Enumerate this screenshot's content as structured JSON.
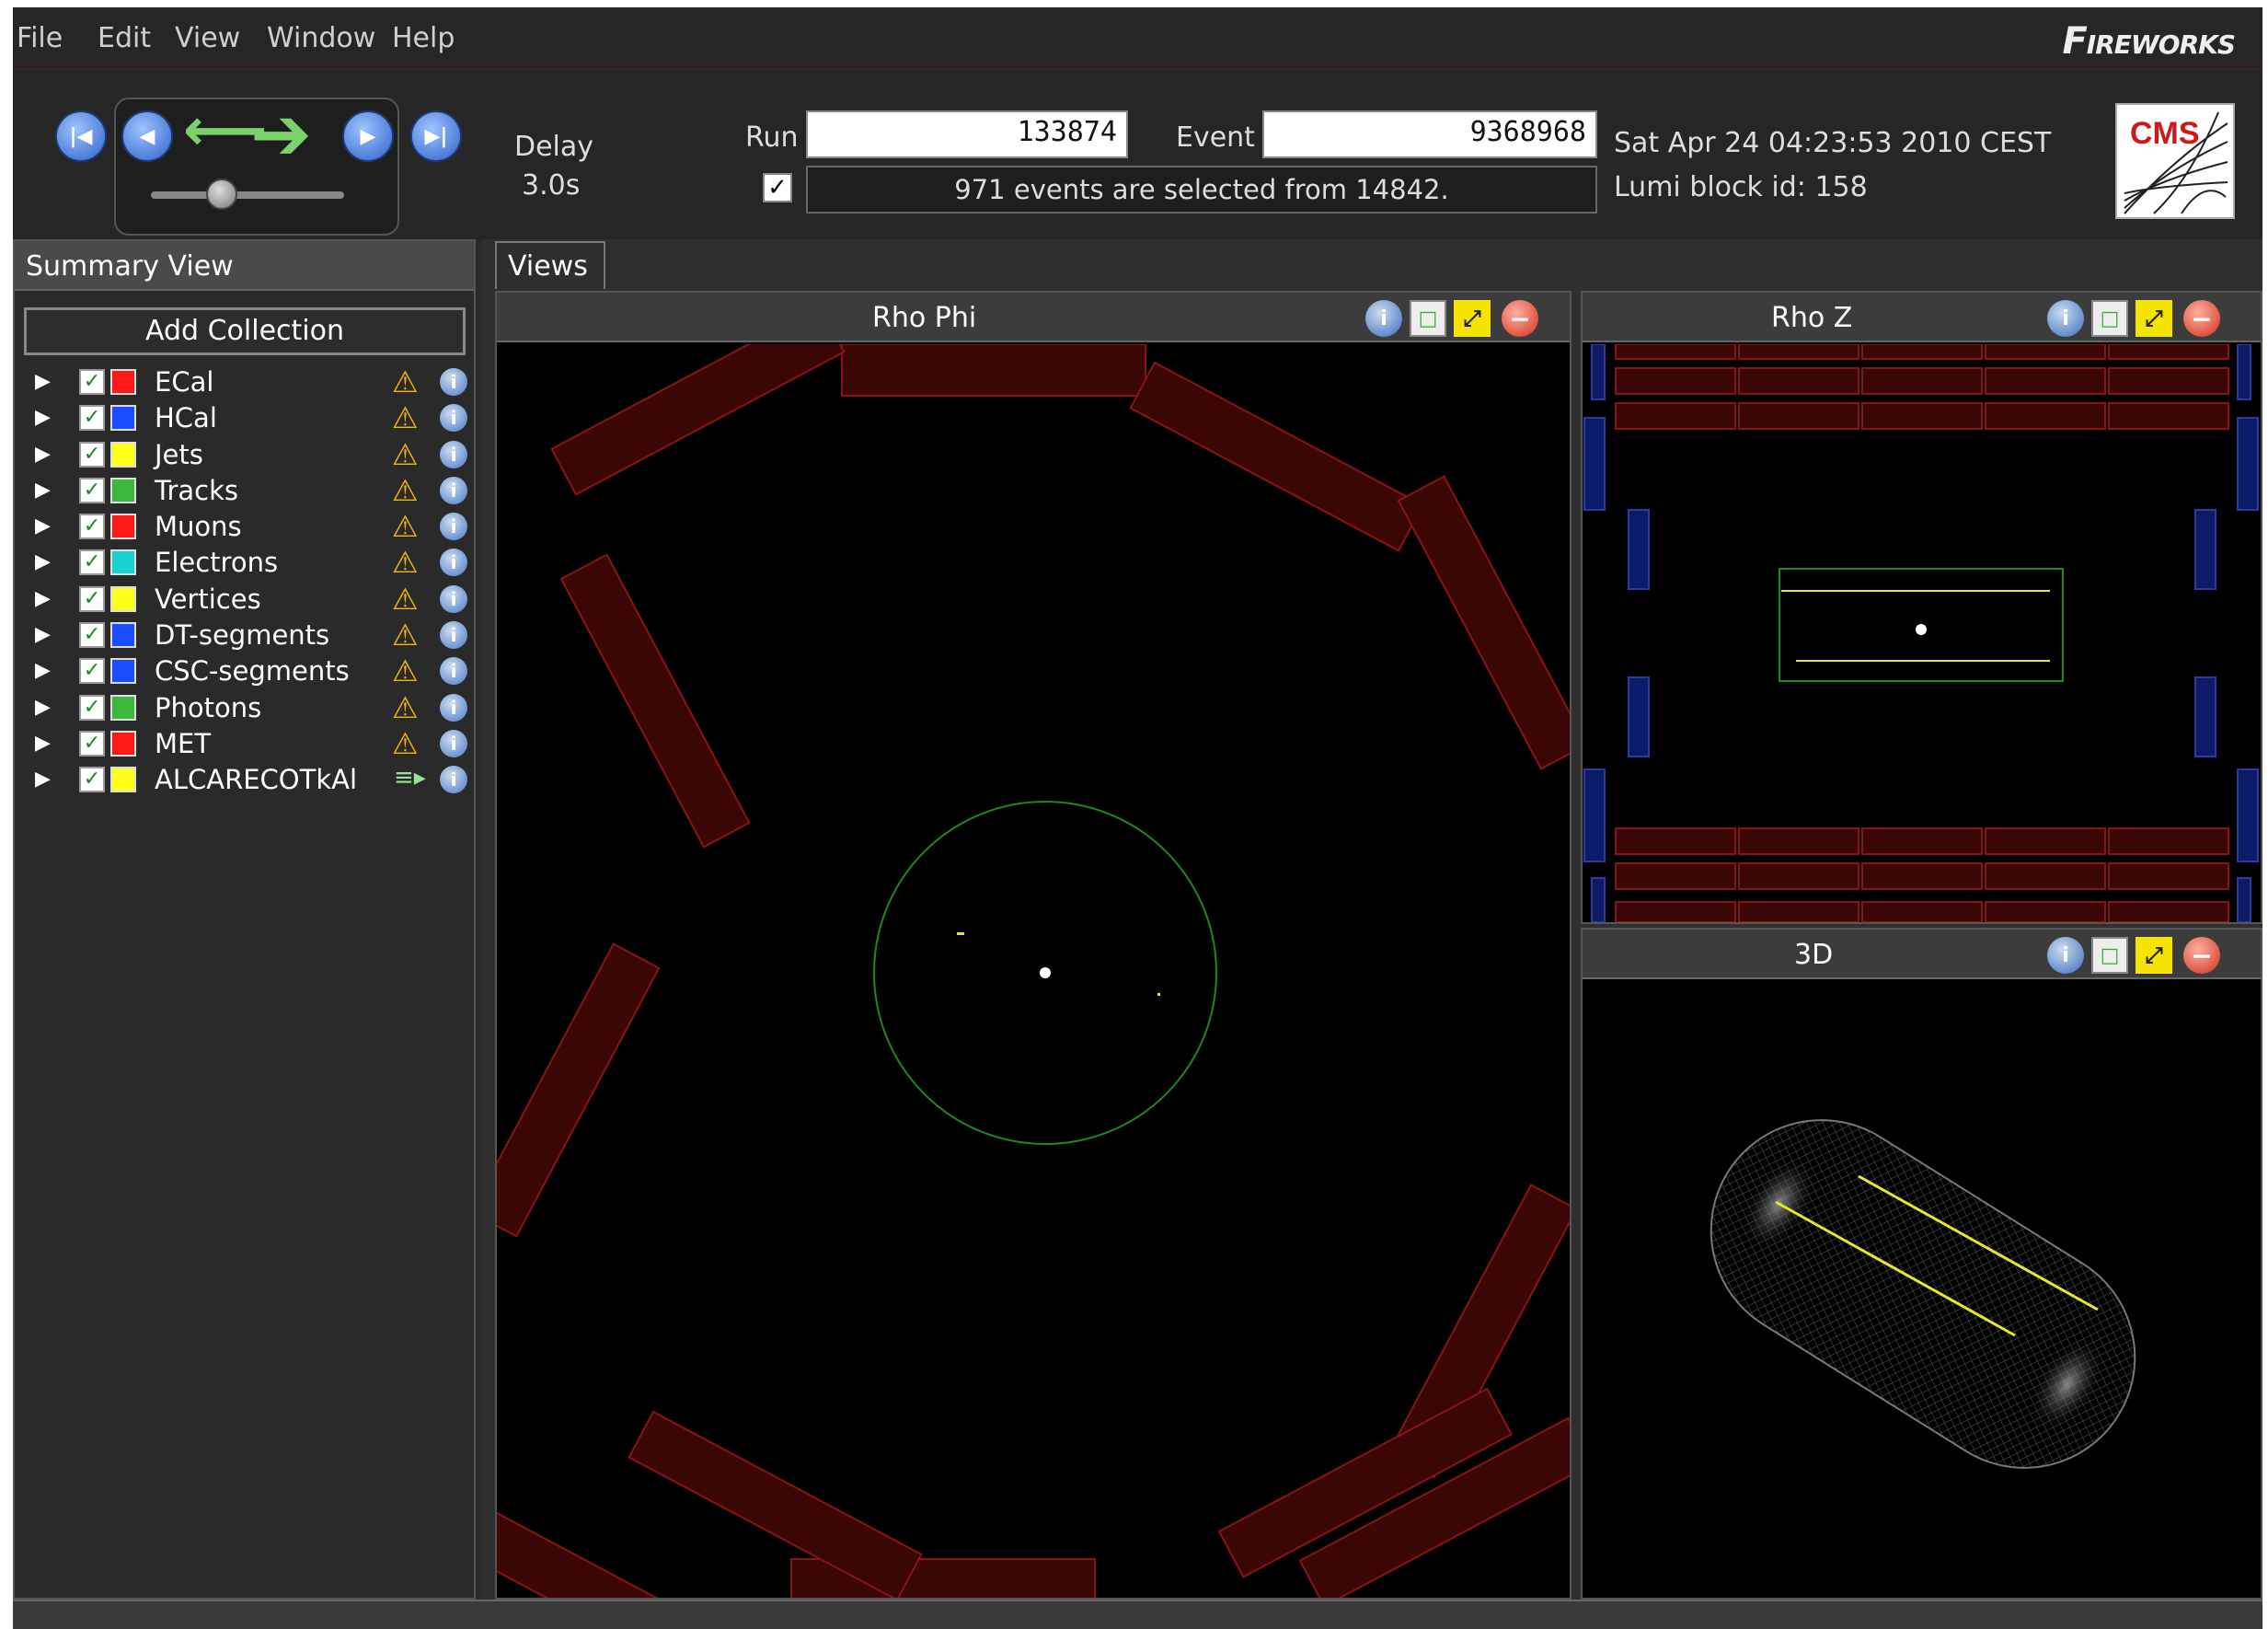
{
  "menu": {
    "items": [
      "File",
      "Edit",
      "View",
      "Window",
      "Help"
    ],
    "brand": "FIREWORKS"
  },
  "toolbar": {
    "delay_label": "Delay",
    "delay_value": "3.0s",
    "run_label": "Run",
    "run_value": "133874",
    "event_label": "Event",
    "event_value": "9368968",
    "filter_checked": true,
    "selection_status": "971 events are selected from 14842.",
    "datetime": "Sat Apr 24 04:23:53 2010 CEST",
    "lumi_block": "Lumi block id: 158",
    "cms_logo_text": "CMS"
  },
  "summary": {
    "title": "Summary View",
    "add_collection_label": "Add Collection",
    "collections": [
      {
        "name": "ECal",
        "color": "#ff1a1a",
        "status": "warning"
      },
      {
        "name": "HCal",
        "color": "#1a4dff",
        "status": "warning"
      },
      {
        "name": "Jets",
        "color": "#ffff1a",
        "status": "warning"
      },
      {
        "name": "Tracks",
        "color": "#3cb83c",
        "status": "warning"
      },
      {
        "name": "Muons",
        "color": "#ff1a1a",
        "status": "warning"
      },
      {
        "name": "Electrons",
        "color": "#1ad1d1",
        "status": "warning"
      },
      {
        "name": "Vertices",
        "color": "#ffff1a",
        "status": "warning"
      },
      {
        "name": "DT-segments",
        "color": "#1a4dff",
        "status": "warning"
      },
      {
        "name": "CSC-segments",
        "color": "#1a4dff",
        "status": "warning"
      },
      {
        "name": "Photons",
        "color": "#3cb83c",
        "status": "warning"
      },
      {
        "name": "MET",
        "color": "#ff1a1a",
        "status": "warning"
      },
      {
        "name": "ALCARECOTkAl",
        "color": "#ffff1a",
        "status": "filter"
      }
    ]
  },
  "views": {
    "tab_label": "Views",
    "panels": [
      {
        "title": "Rho Phi"
      },
      {
        "title": "Rho Z"
      },
      {
        "title": "3D"
      }
    ]
  },
  "icons": {
    "warning": "warning-icon",
    "info": "info-icon",
    "snapshot": "snapshot-icon",
    "maximize": "maximize-icon",
    "close": "close-icon",
    "expand": "triangle-right-icon",
    "filter": "filter-icon"
  },
  "colors": {
    "calo_red": "#6a0c0c",
    "muon_blue": "#0a1a66",
    "beampipe_green": "#1a8a1a",
    "track_yellow": "#e8e82a"
  }
}
